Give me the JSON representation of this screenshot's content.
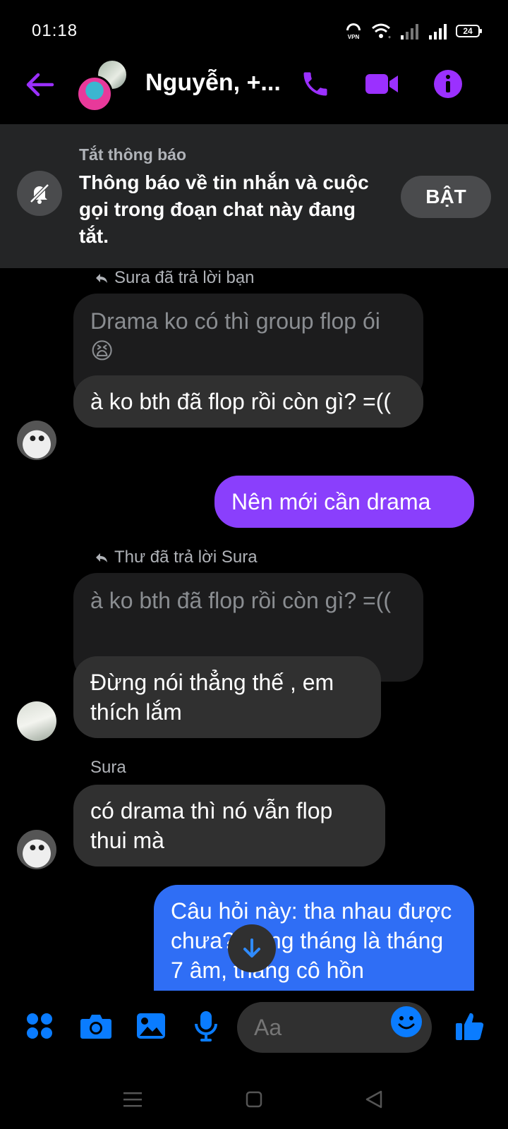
{
  "status_bar": {
    "time": "01:18",
    "battery": "24"
  },
  "header": {
    "title": "Nguyễn, +..."
  },
  "mute_banner": {
    "title": "Tắt thông báo",
    "text": "Thông báo về tin nhắn và cuộc gọi trong đoạn chat này đang tắt.",
    "button_label": "BẬT"
  },
  "messages": {
    "reply1": {
      "label": "Sura đã trả lời bạn",
      "quoted": "Drama ko có thì group flop ói 😫",
      "text": "à ko bth đã flop rồi còn gì? =(("
    },
    "outgoing1": {
      "text": "Nên mới cần drama"
    },
    "reply2": {
      "label": "Thư đã trả lời Sura",
      "quoted": "à ko bth đã flop rồi còn gì? =((",
      "text": "Đừng nói thẳng thế , em thích lắm"
    },
    "sura_msg": {
      "sender": "Sura",
      "text": "có drama thì nó vẫn flop thui mà"
    },
    "outgoing2": {
      "text": "Câu hỏi này: tha nhau được chưa? Sang tháng là tháng 7 âm, tháng cô hồn"
    }
  },
  "composer": {
    "placeholder": "Aa"
  },
  "colors": {
    "accent_purple": "#9b30ff",
    "messenger_blue": "#0a7cff",
    "bubble_incoming": "#303030",
    "bubble_outgoing_purple": "#8a3ffc",
    "bubble_outgoing_blue": "#2f6ef5"
  },
  "icons": [
    "back-arrow-icon",
    "phone-icon",
    "video-icon",
    "info-icon",
    "bell-off-icon",
    "reply-arrow-icon",
    "arrow-down-icon",
    "apps-icon",
    "camera-icon",
    "image-icon",
    "mic-icon",
    "emoji-icon",
    "thumbs-up-icon"
  ]
}
